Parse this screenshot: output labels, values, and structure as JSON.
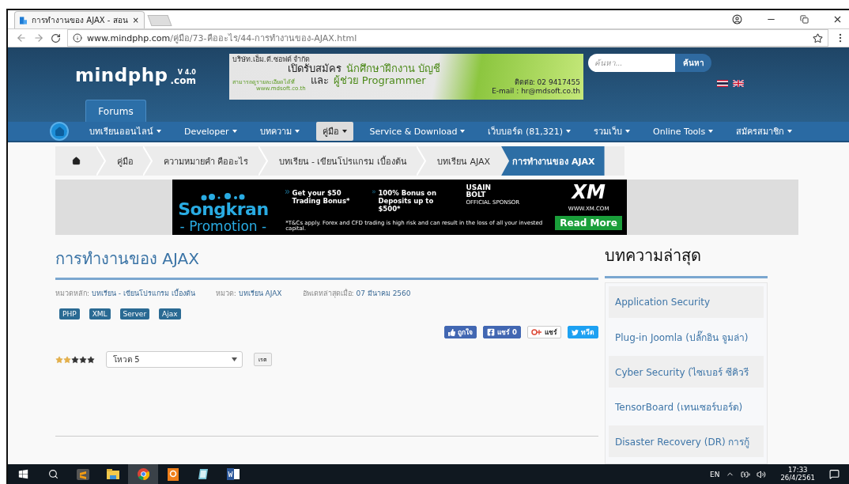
{
  "browser": {
    "tab": {
      "title": "การทำงานของ AJAX - สอน",
      "close": "×"
    },
    "url": {
      "host": "www.mindphp.com",
      "path": "/คู่มือ/73-คืออะไร/44-การทำงานของ-AJAX.html"
    }
  },
  "header": {
    "logo": "mindphp",
    "logo_version": "V 4.0",
    "logo_suffix": ".com",
    "job_ad": {
      "company": "บริษัท.เอ็ม.ดี.ซอฟต์ จำกัด",
      "lead": "เปิดรับสมัคร",
      "position_1": "นักศึกษาฝึกงาน บัญชี",
      "joiner": "และ",
      "position_2": "ผู้ช่วย Programmer",
      "details": "สามารถดูรายละเอียดได้ที่",
      "website": "www.mdsoft.co.th",
      "phone": "ติดต่อ: 02 9417455",
      "email": "E-mail : hr@mdsoft.co.th"
    },
    "search": {
      "placeholder": "ค้นหา...",
      "button": "ค้นหา"
    },
    "forums_tab": "Forums"
  },
  "nav": [
    {
      "label": "บทเรียนออนไลน์",
      "selected": false
    },
    {
      "label": "Developer",
      "selected": false
    },
    {
      "label": "บทความ",
      "selected": false
    },
    {
      "label": "คู่มือ",
      "selected": true
    },
    {
      "label": "Service & Download",
      "selected": false
    },
    {
      "label": "เว็บบอร์ด (81,321)",
      "selected": false
    },
    {
      "label": "รวมเว็บ",
      "selected": false
    },
    {
      "label": "Online Tools",
      "selected": false
    },
    {
      "label": "สมัครสมาชิก",
      "selected": false
    }
  ],
  "breadcrumbs": [
    {
      "label": "คู่มือ",
      "selected": false
    },
    {
      "label": "ความหมายคำ คืออะไร",
      "selected": false
    },
    {
      "label": "บทเรียน - เขียนโปรแกรม เบื้องต้น",
      "selected": false
    },
    {
      "label": "บทเรียน AJAX",
      "selected": false
    },
    {
      "label": "การทำงานของ AJAX",
      "selected": true
    }
  ],
  "promo_ad": {
    "headline": "Songkran",
    "subline": "- Promotion -",
    "offers": [
      "Get your $50 Trading Bonus*",
      "100% Bonus on Deposits up to $500*"
    ],
    "disclaimer": "*T&Cs apply. Forex and CFD trading is high risk and can result in the loss of all your invested capital.",
    "sponsor": "USAIN BOLT",
    "sponsor_note": "OFFICIAL SPONSOR",
    "brand": "XM",
    "brand_site": "WWW.XM.COM",
    "cta": "Read More"
  },
  "article": {
    "title": "การทำงานของ AJAX",
    "meta": [
      {
        "label": "หมวดหลัก:",
        "value": "บทเรียน - เขียนโปรแกรม เบื้องต้น"
      },
      {
        "label": "หมวด:",
        "value": "บทเรียน AJAX"
      },
      {
        "label": "อัพเดทล่าสุดเมื่อ:",
        "value": "07 มีนาคม 2560"
      }
    ],
    "tags": [
      "PHP",
      "XML",
      "Server",
      "Ajax"
    ],
    "share": [
      {
        "kind": "like",
        "label": "ถูกใจ"
      },
      {
        "kind": "facebook",
        "label": "แชร์ 0"
      },
      {
        "kind": "gplus",
        "label": "แชร์"
      },
      {
        "kind": "twitter",
        "label": "ทวีต"
      }
    ],
    "rating": {
      "stars": 2,
      "select": "โหวต 5",
      "button": "เรต"
    }
  },
  "sidebar": {
    "heading": "บทความล่าสุด",
    "items": [
      "Application Security",
      "Plug-in Joomla (ปลั๊กอิน จูมล่า)",
      "Cyber Security (ไซเบอร์ ซีคิวรี",
      "TensorBoard (เทนเซอร์บอร์ด)",
      "Disaster Recovery (DR) การกู้"
    ]
  },
  "taskbar": {
    "language": "EN",
    "time": "17:33",
    "date": "26/4/2561"
  }
}
